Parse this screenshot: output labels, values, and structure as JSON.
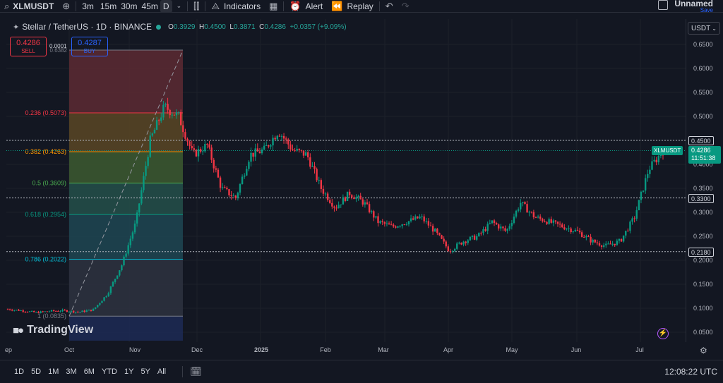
{
  "toolbar": {
    "symbol": "XLMUSDT",
    "timeframes": [
      "3m",
      "15m",
      "30m",
      "45m",
      "D"
    ],
    "active_timeframe": "D",
    "indicators_label": "Indicators",
    "alert_label": "Alert",
    "replay_label": "Replay",
    "layout_name": "Unnamed",
    "save_label": "Save"
  },
  "legend": {
    "title": "Stellar / TetherUS · 1D · BINANCE",
    "open_label": "O",
    "open": "0.3929",
    "high_label": "H",
    "high": "0.4500",
    "low_label": "L",
    "low": "0.3871",
    "close_label": "C",
    "close": "0.4286",
    "change": "+0.0357 (+9.09%)"
  },
  "order": {
    "sell_price": "0.4286",
    "sell_label": "SELL",
    "buy_price": "0.4287",
    "buy_label": "BUY",
    "spread": "0.0001"
  },
  "currency": "USDT",
  "price_scale": {
    "ticks": [
      "0.6500",
      "0.6000",
      "0.5500",
      "0.5000",
      "0.4500",
      "0.4000",
      "0.3500",
      "0.3000",
      "0.2500",
      "0.2000",
      "0.1500",
      "0.1000",
      "0.0500"
    ],
    "label_4500": "0.4500",
    "label_3300": "0.3300",
    "label_2180": "0.2180",
    "last_price": "0.4286",
    "countdown": "11:51:38",
    "symbol_tag": "XLMUSDT"
  },
  "time_scale": {
    "labels": [
      "ep",
      "Oct",
      "Nov",
      "Dec",
      "2025",
      "Feb",
      "Mar",
      "Apr",
      "May",
      "Jun",
      "Jul"
    ]
  },
  "fib": {
    "top_label": "0.6382",
    "levels": [
      {
        "label": "0.236 (0.5073)",
        "color": "#f23645"
      },
      {
        "label": "0.382 (0.4263)",
        "color": "#ff9800"
      },
      {
        "label": "0.5 (0.3609)",
        "color": "#4caf50"
      },
      {
        "label": "0.618 (0.2954)",
        "color": "#089981"
      },
      {
        "label": "0.786 (0.2022)",
        "color": "#00bcd4"
      },
      {
        "label": "1 (0.0835)",
        "color": "#787b86"
      }
    ]
  },
  "branding": "TradingView",
  "range_buttons": [
    "1D",
    "5D",
    "1M",
    "3M",
    "6M",
    "YTD",
    "1Y",
    "5Y",
    "All"
  ],
  "clock": "12:08:22 UTC",
  "chart_data": {
    "type": "candlestick",
    "symbol": "XLMUSDT",
    "ylim": [
      0.02,
      0.68
    ],
    "horizontal_lines": [
      0.45,
      0.33,
      0.218
    ],
    "fibonacci": {
      "from": 0.6382,
      "to": 0.0835,
      "levels": [
        0.236,
        0.382,
        0.5,
        0.618,
        0.786,
        1
      ]
    },
    "close_path": [
      [
        "Sep",
        0.098
      ],
      [
        "Sep",
        0.095
      ],
      [
        "Oct",
        0.091
      ],
      [
        "Oct",
        0.094
      ],
      [
        "Oct",
        0.095
      ],
      [
        "Nov",
        0.092
      ],
      [
        "Nov",
        0.097
      ],
      [
        "Nov",
        0.13
      ],
      [
        "Nov",
        0.19
      ],
      [
        "Nov",
        0.28
      ],
      [
        "Nov",
        0.45
      ],
      [
        "Dec",
        0.52
      ],
      [
        "Dec",
        0.5
      ],
      [
        "Dec",
        0.42
      ],
      [
        "Dec",
        0.44
      ],
      [
        "Dec",
        0.35
      ],
      [
        "Dec",
        0.33
      ],
      [
        "2025",
        0.42
      ],
      [
        "2025",
        0.43
      ],
      [
        "2025",
        0.47
      ],
      [
        "2025",
        0.43
      ],
      [
        "2025",
        0.42
      ],
      [
        "Feb",
        0.35
      ],
      [
        "Feb",
        0.31
      ],
      [
        "Feb",
        0.34
      ],
      [
        "Feb",
        0.32
      ],
      [
        "Mar",
        0.28
      ],
      [
        "Mar",
        0.27
      ],
      [
        "Mar",
        0.28
      ],
      [
        "Mar",
        0.29
      ],
      [
        "Apr",
        0.26
      ],
      [
        "Apr",
        0.22
      ],
      [
        "Apr",
        0.24
      ],
      [
        "Apr",
        0.25
      ],
      [
        "May",
        0.28
      ],
      [
        "May",
        0.26
      ],
      [
        "May",
        0.32
      ],
      [
        "May",
        0.29
      ],
      [
        "Jun",
        0.28
      ],
      [
        "Jun",
        0.27
      ],
      [
        "Jun",
        0.26
      ],
      [
        "Jun",
        0.24
      ],
      [
        "Jul",
        0.23
      ],
      [
        "Jul",
        0.24
      ],
      [
        "Jul",
        0.29
      ],
      [
        "Jul",
        0.39
      ],
      [
        "Jul",
        0.4286
      ]
    ]
  }
}
